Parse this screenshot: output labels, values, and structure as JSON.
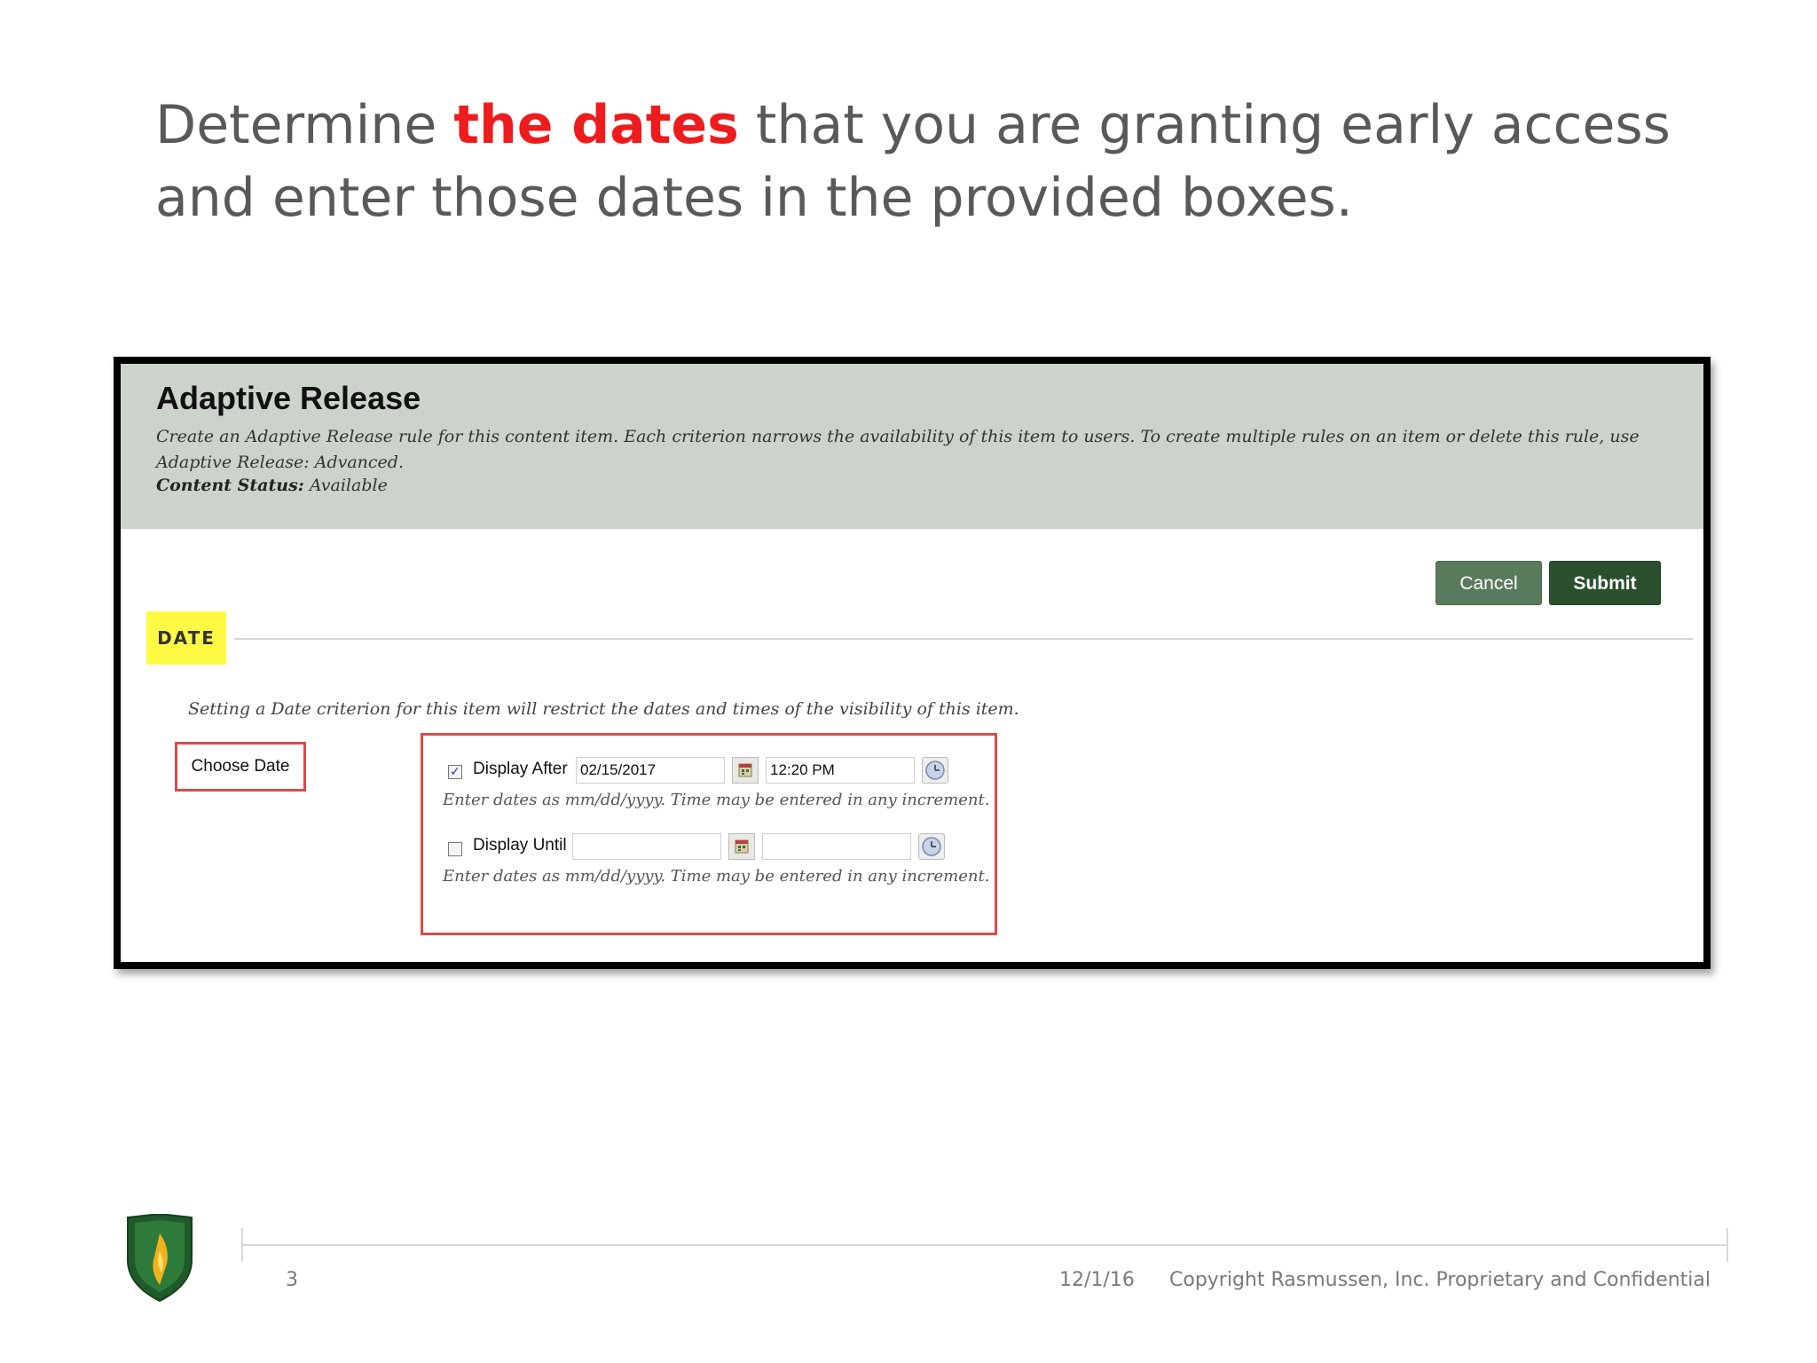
{
  "slide": {
    "title_before": "Determine ",
    "title_highlight": "the dates",
    "title_after": " that you are granting early access and enter those dates in the provided boxes."
  },
  "adaptive_release": {
    "title": "Adaptive Release",
    "description": "Create an Adaptive Release rule for this content item. Each criterion narrows the availability of this item to users. To create multiple rules on an item or delete this rule, use Adaptive Release: Advanced.",
    "status_label": "Content Status:",
    "status_value": "Available",
    "cancel_label": "Cancel",
    "submit_label": "Submit"
  },
  "date_section": {
    "badge": "DATE",
    "info": "Setting a Date criterion for this item will restrict the dates and times of the visibility of this item.",
    "choose_label": "Choose Date",
    "display_after": {
      "label": "Display After",
      "checked": true,
      "date_value": "02/15/2017",
      "time_value": "12:20 PM",
      "hint": "Enter dates as mm/dd/yyyy. Time may be entered in any increment."
    },
    "display_until": {
      "label": "Display Until",
      "checked": false,
      "date_value": "",
      "time_value": "",
      "hint": "Enter dates as mm/dd/yyyy. Time may be entered in any increment."
    }
  },
  "footer": {
    "page_number": "3",
    "date": "12/1/16",
    "copyright": "Copyright Rasmussen, Inc. Proprietary and Confidential"
  },
  "colors": {
    "highlight": "#ee1c1c",
    "header_bg": "#cbd3cb",
    "submit_bg": "#2b4f2f",
    "cancel_bg": "#5a7a5e",
    "badge_bg": "#fffb44",
    "callout_red": "#e04848"
  },
  "icons": {
    "calendar": "calendar-icon",
    "clock": "clock-icon",
    "logo": "rasmussen-shield-logo"
  }
}
